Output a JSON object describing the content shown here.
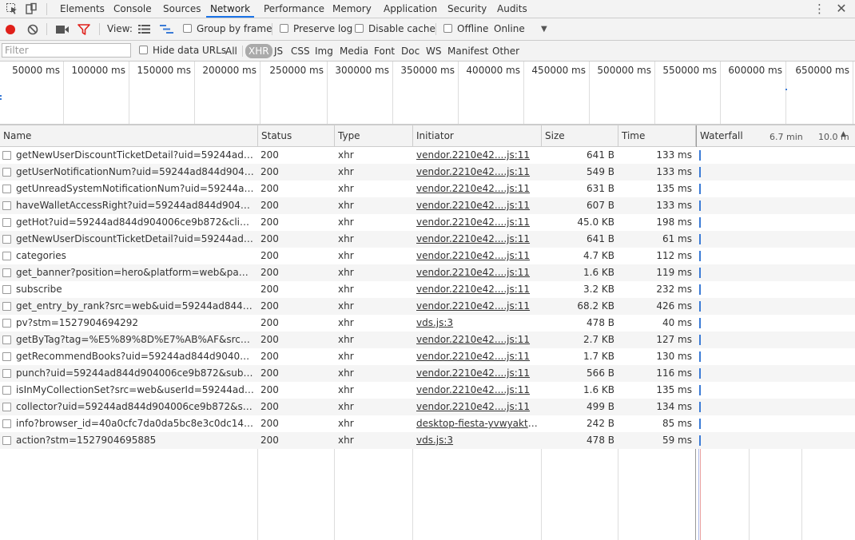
{
  "tabs": {
    "items": [
      "Elements",
      "Console",
      "Sources",
      "Network",
      "Performance",
      "Memory",
      "Application",
      "Security",
      "Audits"
    ],
    "active": "Network"
  },
  "toolbar": {
    "view_label": "View:",
    "group_by_frame": "Group by frame",
    "preserve_log": "Preserve log",
    "disable_cache": "Disable cache",
    "offline": "Offline",
    "throttle": "Online"
  },
  "filterbar": {
    "filter_placeholder": "Filter",
    "hide_data_urls": "Hide data URLs",
    "types": [
      "All",
      "XHR",
      "JS",
      "CSS",
      "Img",
      "Media",
      "Font",
      "Doc",
      "WS",
      "Manifest",
      "Other"
    ],
    "active_type": "XHR"
  },
  "overview": {
    "ticks": [
      "50000 ms",
      "100000 ms",
      "150000 ms",
      "200000 ms",
      "250000 ms",
      "300000 ms",
      "350000 ms",
      "400000 ms",
      "450000 ms",
      "500000 ms",
      "550000 ms",
      "600000 ms",
      "650000 ms"
    ]
  },
  "grid": {
    "headers": {
      "name": "Name",
      "status": "Status",
      "type": "Type",
      "initiator": "Initiator",
      "size": "Size",
      "time": "Time",
      "waterfall": "Waterfall",
      "wf_tick1": "6.7 min",
      "wf_tick2": "10.0 m"
    },
    "rows": [
      {
        "name": "getNewUserDiscountTicketDetail?uid=59244ad844d9...",
        "status": "200",
        "type": "xhr",
        "initiator": "vendor.2210e42....js:11",
        "size": "641 B",
        "time": "133 ms"
      },
      {
        "name": "getUserNotificationNum?uid=59244ad844d904006ce...",
        "status": "200",
        "type": "xhr",
        "initiator": "vendor.2210e42....js:11",
        "size": "549 B",
        "time": "133 ms"
      },
      {
        "name": "getUnreadSystemNotificationNum?uid=59244ad844d...",
        "status": "200",
        "type": "xhr",
        "initiator": "vendor.2210e42....js:11",
        "size": "631 B",
        "time": "135 ms"
      },
      {
        "name": "haveWalletAccessRight?uid=59244ad844d904006ce9b...",
        "status": "200",
        "type": "xhr",
        "initiator": "vendor.2210e42....js:11",
        "size": "607 B",
        "time": "133 ms"
      },
      {
        "name": "getHot?uid=59244ad844d904006ce9b872&client_id=...",
        "status": "200",
        "type": "xhr",
        "initiator": "vendor.2210e42....js:11",
        "size": "45.0 KB",
        "time": "198 ms"
      },
      {
        "name": "getNewUserDiscountTicketDetail?uid=59244ad844d9...",
        "status": "200",
        "type": "xhr",
        "initiator": "vendor.2210e42....js:11",
        "size": "641 B",
        "time": "61 ms"
      },
      {
        "name": "categories",
        "status": "200",
        "type": "xhr",
        "initiator": "vendor.2210e42....js:11",
        "size": "4.7 KB",
        "time": "112 ms"
      },
      {
        "name": "get_banner?position=hero&platform=web&page=0&...",
        "status": "200",
        "type": "xhr",
        "initiator": "vendor.2210e42....js:11",
        "size": "1.6 KB",
        "time": "119 ms"
      },
      {
        "name": "subscribe",
        "status": "200",
        "type": "xhr",
        "initiator": "vendor.2210e42....js:11",
        "size": "3.2 KB",
        "time": "232 ms"
      },
      {
        "name": "get_entry_by_rank?src=web&uid=59244ad844d90400...",
        "status": "200",
        "type": "xhr",
        "initiator": "vendor.2210e42....js:11",
        "size": "68.2 KB",
        "time": "426 ms"
      },
      {
        "name": "pv?stm=1527904694292",
        "status": "200",
        "type": "xhr",
        "initiator": "vds.js:3",
        "size": "478 B",
        "time": "40 ms"
      },
      {
        "name": "getByTag?tag=%E5%89%8D%E7%AB%AF&src=web&t...",
        "status": "200",
        "type": "xhr",
        "initiator": "vendor.2210e42....js:11",
        "size": "2.7 KB",
        "time": "127 ms"
      },
      {
        "name": "getRecommendBooks?uid=59244ad844d904006ce9b...",
        "status": "200",
        "type": "xhr",
        "initiator": "vendor.2210e42....js:11",
        "size": "1.7 KB",
        "time": "130 ms"
      },
      {
        "name": "punch?uid=59244ad844d904006ce9b872&sub_locatio...",
        "status": "200",
        "type": "xhr",
        "initiator": "vendor.2210e42....js:11",
        "size": "566 B",
        "time": "116 ms"
      },
      {
        "name": "isInMyCollectionSet?src=web&userId=59244ad844d9...",
        "status": "200",
        "type": "xhr",
        "initiator": "vendor.2210e42....js:11",
        "size": "1.6 KB",
        "time": "135 ms"
      },
      {
        "name": "collector?uid=59244ad844d904006ce9b872&suid=rjA...",
        "status": "200",
        "type": "xhr",
        "initiator": "vendor.2210e42....js:11",
        "size": "499 B",
        "time": "134 ms"
      },
      {
        "name": "info?browser_id=40a0cfc7da0da5bc8e3c0dc14742e26...",
        "status": "200",
        "type": "xhr",
        "initiator": "desktop-fiesta-yvwyaktrny...",
        "size": "242 B",
        "time": "85 ms"
      },
      {
        "name": "action?stm=1527904695885",
        "status": "200",
        "type": "xhr",
        "initiator": "vds.js:3",
        "size": "478 B",
        "time": "59 ms"
      }
    ]
  }
}
